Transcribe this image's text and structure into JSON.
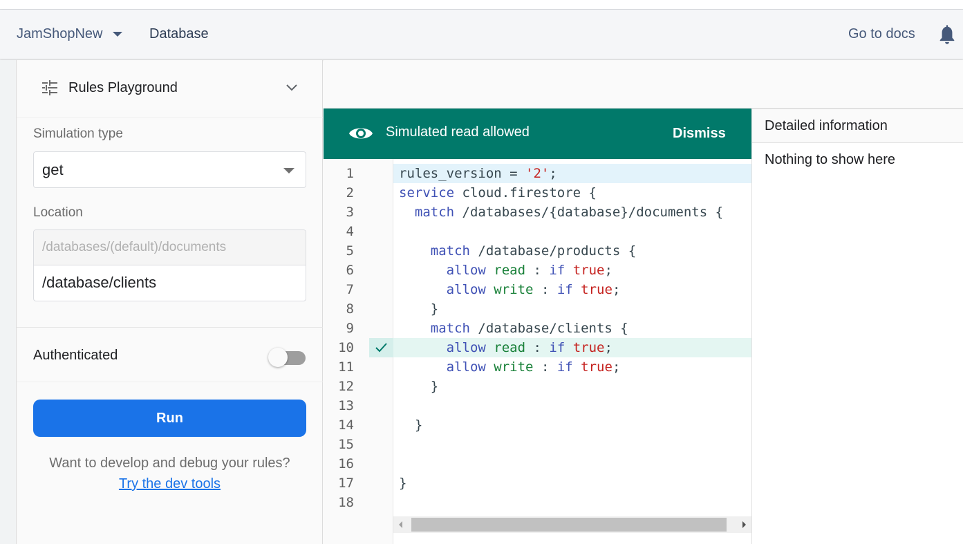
{
  "header": {
    "project_name": "JamShopNew",
    "breadcrumb": "Database",
    "docs_link": "Go to docs",
    "notifications_icon": "bell-icon"
  },
  "playground": {
    "title": "Rules Playground",
    "icon": "tune-sliders-icon",
    "simulation_type_label": "Simulation type",
    "simulation_type_value": "get",
    "location_label": "Location",
    "location_prefix": "/databases/(default)/documents",
    "location_path": "/database/clients",
    "authenticated_label": "Authenticated",
    "authenticated": false,
    "run_label": "Run",
    "hint_text": "Want to develop and debug your rules?",
    "dev_tools_link": "Try the dev tools"
  },
  "banner": {
    "message": "Simulated read allowed",
    "dismiss_label": "Dismiss",
    "color": "#01796a"
  },
  "editor": {
    "highlighted_line": 10,
    "lines": [
      {
        "n": "1",
        "parts": [
          [
            "",
            "rules_version = "
          ],
          [
            "red",
            "'2'"
          ],
          [
            "",
            ";"
          ]
        ]
      },
      {
        "n": "2",
        "parts": [
          [
            "kw",
            "service"
          ],
          [
            "",
            " cloud.firestore {"
          ]
        ]
      },
      {
        "n": "3",
        "parts": [
          [
            "",
            "  "
          ],
          [
            "kw",
            "match"
          ],
          [
            "",
            " /databases/{database}/documents {"
          ]
        ]
      },
      {
        "n": "4",
        "parts": []
      },
      {
        "n": "5",
        "parts": [
          [
            "",
            "    "
          ],
          [
            "kw",
            "match"
          ],
          [
            "",
            " /database/products {"
          ]
        ]
      },
      {
        "n": "6",
        "parts": [
          [
            "",
            "      "
          ],
          [
            "kw",
            "allow"
          ],
          [
            "",
            " "
          ],
          [
            "grn",
            "read"
          ],
          [
            "",
            " : "
          ],
          [
            "kw",
            "if"
          ],
          [
            "",
            " "
          ],
          [
            "red",
            "true"
          ],
          [
            "",
            ";"
          ]
        ]
      },
      {
        "n": "7",
        "parts": [
          [
            "",
            "      "
          ],
          [
            "kw",
            "allow"
          ],
          [
            "",
            " "
          ],
          [
            "grn",
            "write"
          ],
          [
            "",
            " : "
          ],
          [
            "kw",
            "if"
          ],
          [
            "",
            " "
          ],
          [
            "red",
            "true"
          ],
          [
            "",
            ";"
          ]
        ]
      },
      {
        "n": "8",
        "parts": [
          [
            "",
            "    }"
          ]
        ]
      },
      {
        "n": "9",
        "parts": [
          [
            "",
            "    "
          ],
          [
            "kw",
            "match"
          ],
          [
            "",
            " /database/clients {"
          ]
        ]
      },
      {
        "n": "10",
        "parts": [
          [
            "",
            "      "
          ],
          [
            "kw",
            "allow"
          ],
          [
            "",
            " "
          ],
          [
            "grn",
            "read"
          ],
          [
            "",
            " : "
          ],
          [
            "kw",
            "if"
          ],
          [
            "",
            " "
          ],
          [
            "red",
            "true"
          ],
          [
            "",
            ";"
          ]
        ]
      },
      {
        "n": "11",
        "parts": [
          [
            "",
            "      "
          ],
          [
            "kw",
            "allow"
          ],
          [
            "",
            " "
          ],
          [
            "grn",
            "write"
          ],
          [
            "",
            " : "
          ],
          [
            "kw",
            "if"
          ],
          [
            "",
            " "
          ],
          [
            "red",
            "true"
          ],
          [
            "",
            ";"
          ]
        ]
      },
      {
        "n": "12",
        "parts": [
          [
            "",
            "    }"
          ]
        ]
      },
      {
        "n": "13",
        "parts": []
      },
      {
        "n": "14",
        "parts": [
          [
            "",
            "  }"
          ]
        ]
      },
      {
        "n": "15",
        "parts": []
      },
      {
        "n": "16",
        "parts": []
      },
      {
        "n": "17",
        "parts": [
          [
            "",
            "}"
          ]
        ]
      },
      {
        "n": "18",
        "parts": []
      }
    ]
  },
  "detail": {
    "title": "Detailed information",
    "empty_text": "Nothing to show here"
  }
}
